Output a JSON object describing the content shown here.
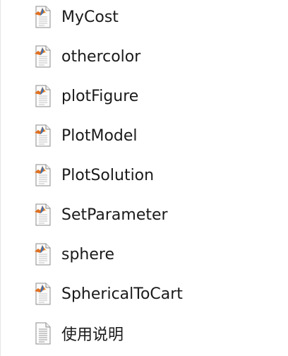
{
  "files": [
    {
      "name": "MyCost",
      "icon": "matlab-file-icon"
    },
    {
      "name": "othercolor",
      "icon": "matlab-file-icon"
    },
    {
      "name": "plotFigure",
      "icon": "matlab-file-icon"
    },
    {
      "name": "PlotModel",
      "icon": "matlab-file-icon"
    },
    {
      "name": "PlotSolution",
      "icon": "matlab-file-icon"
    },
    {
      "name": "SetParameter",
      "icon": "matlab-file-icon"
    },
    {
      "name": "sphere",
      "icon": "matlab-file-icon"
    },
    {
      "name": "SphericalToCart",
      "icon": "matlab-file-icon"
    },
    {
      "name": "使用说明",
      "icon": "text-file-icon"
    }
  ]
}
